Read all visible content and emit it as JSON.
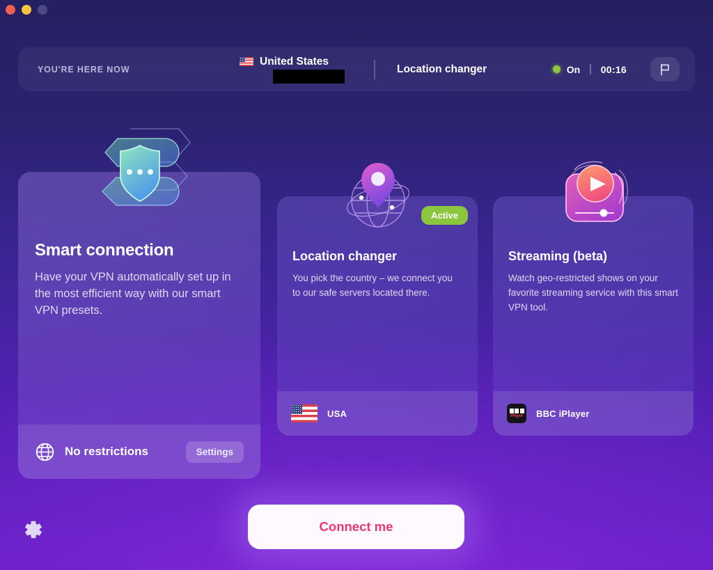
{
  "window": {
    "traffic_lights": [
      "close",
      "minimize",
      "zoom"
    ],
    "colors": {
      "close": "#ef5f54",
      "minimize": "#f5c342",
      "zoom": "#4a4a80"
    }
  },
  "header": {
    "here_now_label": "YOU'RE HERE NOW",
    "country": "United States",
    "country_flag_icon": "us-flag-icon",
    "ip_redacted": "",
    "mode_label": "Location changer",
    "status_text": "On",
    "status_color": "#8cc63d",
    "timer": "00:16",
    "flag_button_icon": "flag-icon"
  },
  "cards": [
    {
      "id": "smart-connection",
      "icon": "shield-presets-icon",
      "title": "Smart connection",
      "description": "Have your VPN automatically set up in the most efficient way with our smart VPN presets.",
      "footer_icon": "globe-icon",
      "footer_label": "No restrictions",
      "action_label": "Settings",
      "badge": null
    },
    {
      "id": "location-changer",
      "icon": "globe-pin-icon",
      "title": "Location changer",
      "description": "You pick the country – we connect you to our safe servers located there.",
      "footer_icon": "us-flag-icon",
      "footer_label": "USA",
      "badge": "Active",
      "badge_color": "#8cc63f"
    },
    {
      "id": "streaming-beta",
      "icon": "streaming-play-icon",
      "title": "Streaming (beta)",
      "description": "Watch geo-restricted shows on your favorite streaming service with this smart VPN tool.",
      "footer_icon": "bbc-iplayer-logo",
      "footer_label": "BBC iPlayer",
      "badge": null
    }
  ],
  "footer": {
    "connect_label": "Connect me",
    "connect_text_color": "#e8386f",
    "settings_gear_icon": "gear-icon"
  }
}
